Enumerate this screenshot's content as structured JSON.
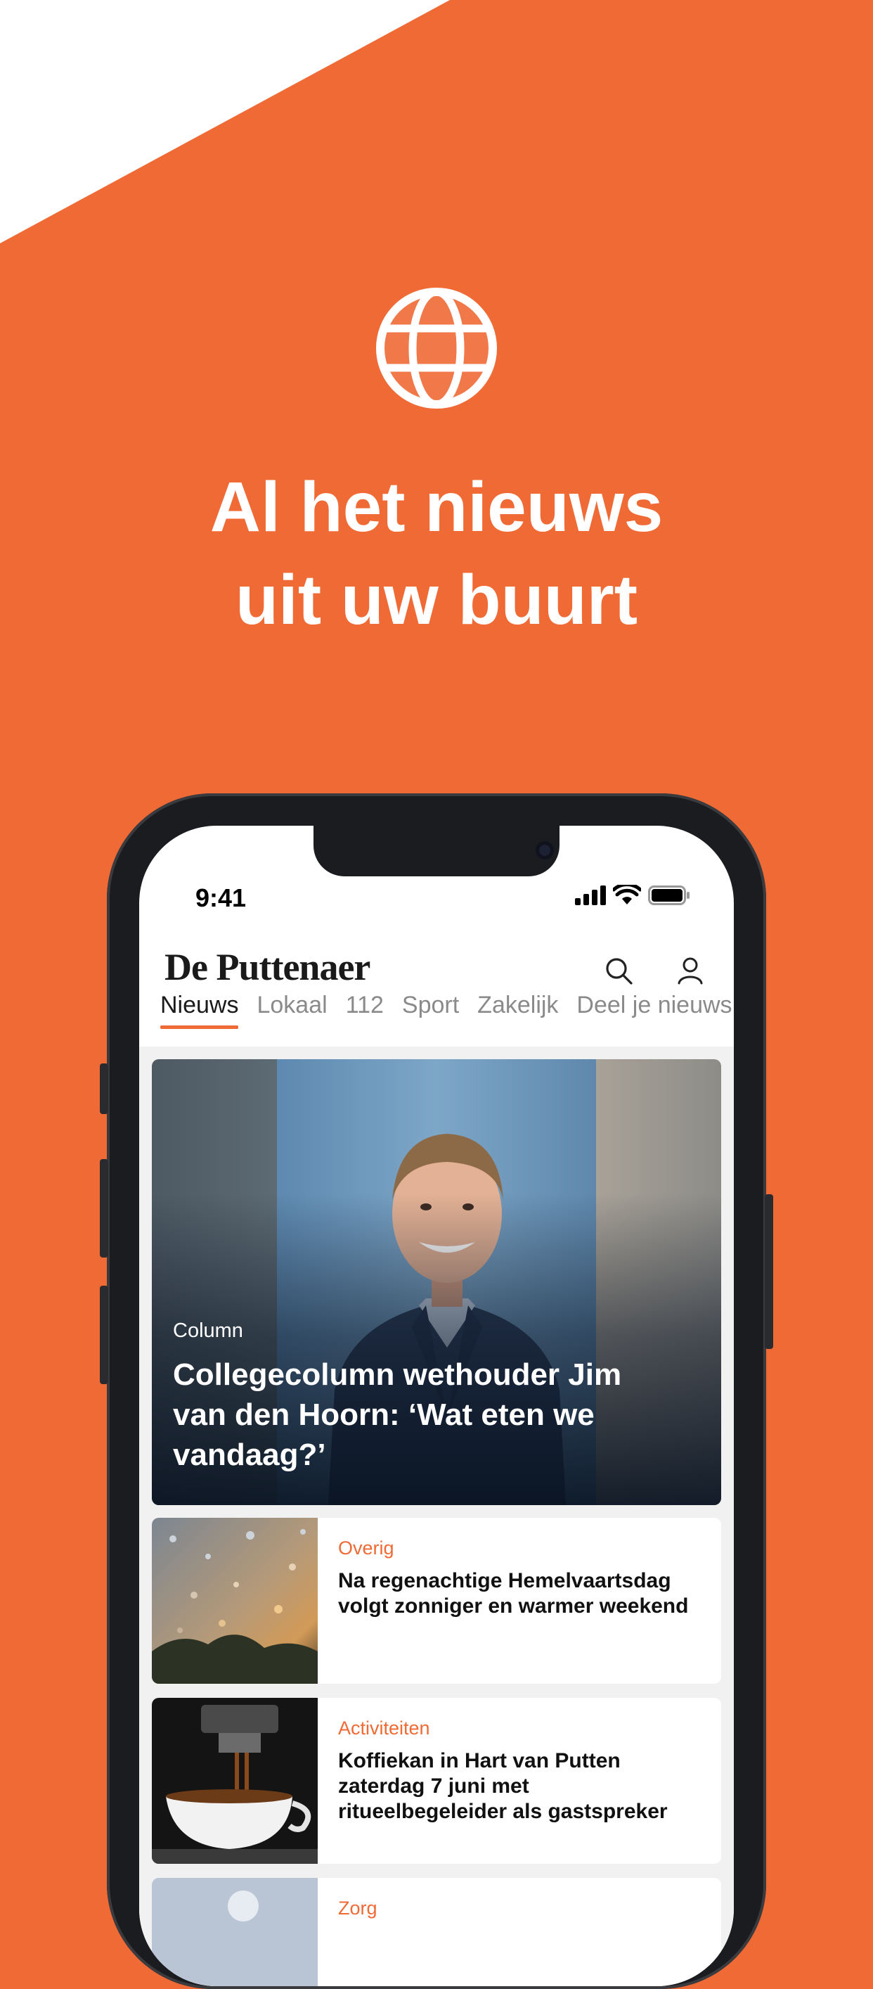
{
  "colors": {
    "brand": "#F06A35",
    "white": "#FFFFFF"
  },
  "hero_icon": "globe-icon",
  "headline": {
    "line1": "Al het nieuws",
    "line2": "uit uw buurt"
  },
  "status_bar": {
    "time": "9:41"
  },
  "app": {
    "name": "De Puttenaer",
    "tabs": [
      "Nieuws",
      "Lokaal",
      "112",
      "Sport",
      "Zakelijk",
      "Deel je nieuws"
    ],
    "active_tab": "Nieuws"
  },
  "featured": {
    "category": "Column",
    "title": "Collegecolumn wethouder Jim van den Hoorn: ‘Wat eten we vandaag?’"
  },
  "articles": [
    {
      "category": "Overig",
      "title": "Na regenachtige Hemelvaartsdag volgt zonniger en warmer weekend"
    },
    {
      "category": "Activiteiten",
      "title": "Koffiekan in Hart van Putten zaterdag 7 juni met ritueelbegeleider als gastspreker"
    },
    {
      "category": "Zorg",
      "title": ""
    }
  ]
}
